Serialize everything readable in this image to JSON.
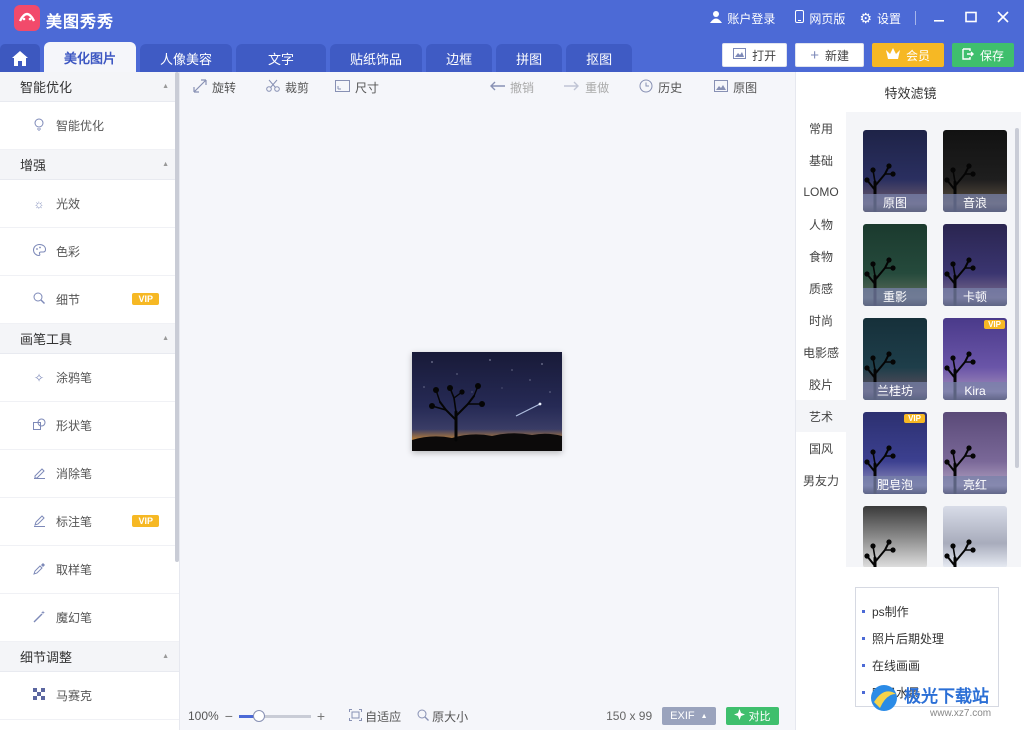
{
  "app": {
    "title": "美图秀秀",
    "logo": "meitu-logo"
  },
  "titlebar": {
    "account_login": "账户登录",
    "web_version": "网页版",
    "settings": "设置"
  },
  "tabs": [
    "美化图片",
    "人像美容",
    "文字",
    "贴纸饰品",
    "边框",
    "拼图",
    "抠图"
  ],
  "active_tab": "美化图片",
  "actions": {
    "open": "打开",
    "new": "新建",
    "member": "会员",
    "save": "保存"
  },
  "left_panel": {
    "sections": [
      {
        "title": "智能优化",
        "tools": [
          {
            "label": "智能优化",
            "icon": "bulb-icon"
          }
        ]
      },
      {
        "title": "增强",
        "tools": [
          {
            "label": "光效",
            "icon": "sun-icon"
          },
          {
            "label": "色彩",
            "icon": "palette-icon"
          },
          {
            "label": "细节",
            "icon": "magnifier-icon",
            "vip": "VIP"
          }
        ]
      },
      {
        "title": "画笔工具",
        "tools": [
          {
            "label": "涂鸦笔",
            "icon": "doodle-pen-icon"
          },
          {
            "label": "形状笔",
            "icon": "shape-pen-icon"
          },
          {
            "label": "消除笔",
            "icon": "eraser-pen-icon"
          },
          {
            "label": "标注笔",
            "icon": "annotate-pen-icon",
            "vip": "VIP"
          },
          {
            "label": "取样笔",
            "icon": "eyedropper-icon"
          },
          {
            "label": "魔幻笔",
            "icon": "magic-pen-icon"
          }
        ]
      },
      {
        "title": "细节调整",
        "tools": [
          {
            "label": "马赛克",
            "icon": "mosaic-icon"
          }
        ]
      }
    ]
  },
  "canvas_toolbar": {
    "rotate": "旋转",
    "crop": "裁剪",
    "size": "尺寸",
    "undo": "撤销",
    "redo": "重做",
    "history": "历史",
    "original": "原图"
  },
  "bottom_bar": {
    "zoom": "100%",
    "zoom_level": 1.0,
    "fit": "自适应",
    "actual_size": "原大小",
    "dimensions": "150 x 99",
    "exif": "EXIF",
    "compare": "对比"
  },
  "right_panel": {
    "title": "特效滤镜",
    "categories": [
      "常用",
      "基础",
      "LOMO",
      "人物",
      "食物",
      "质感",
      "时尚",
      "电影感",
      "胶片",
      "艺术",
      "国风",
      "男友力"
    ],
    "active_category": "艺术",
    "filters": [
      {
        "label": "原图"
      },
      {
        "label": "音浪"
      },
      {
        "label": "重影"
      },
      {
        "label": "卡顿"
      },
      {
        "label": "兰桂坊"
      },
      {
        "label": "Kira",
        "vip": "VIP"
      },
      {
        "label": "肥皂泡",
        "vip": "VIP"
      },
      {
        "label": "亮红"
      },
      {
        "label": ""
      },
      {
        "label": ""
      }
    ]
  },
  "ad_links": [
    "ps制作",
    "照片后期处理",
    "在线画画",
    "喷泉水景"
  ],
  "watermark": {
    "text": "极光下载站",
    "url": "www.xz7.com"
  }
}
